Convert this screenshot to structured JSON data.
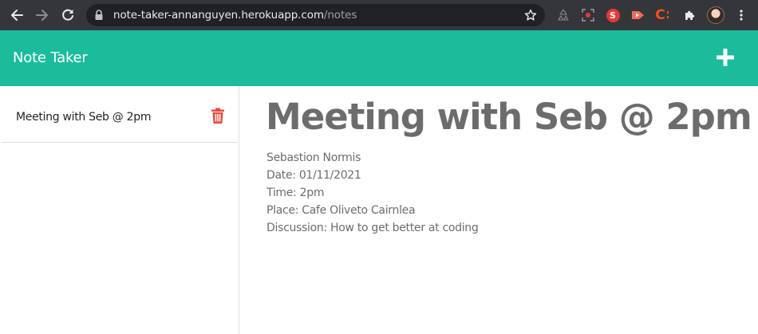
{
  "browser": {
    "url_host": "note-taker-annanguyen.herokuapp.com",
    "url_path": "/notes",
    "icons": {
      "back": "arrow-left-icon",
      "forward": "arrow-right-icon",
      "reload": "reload-icon",
      "lock": "lock-icon",
      "bookmark": "star-icon",
      "extensions": "puzzle-icon",
      "menu": "kebab-menu-icon"
    },
    "extension_s_label": "S",
    "extension_c_label": "C"
  },
  "app": {
    "brand": "Note Taker",
    "accent_color": "#1abc9c",
    "delete_color": "#e74c3c"
  },
  "notes": [
    {
      "title": "Meeting with Seb @ 2pm"
    }
  ],
  "active_note": {
    "title": "Meeting with Seb @ 2pm",
    "lines": [
      "Sebastion Normis",
      "Date: 01/11/2021",
      "Time: 2pm",
      "Place: Cafe Oliveto Cairnlea",
      "Discussion: How to get better at coding"
    ]
  }
}
